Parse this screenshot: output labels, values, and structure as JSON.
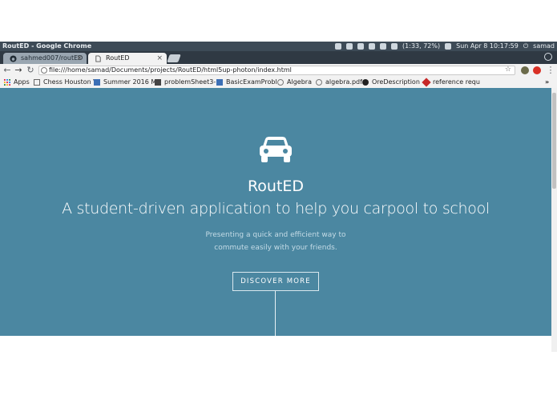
{
  "window": {
    "title": "RoutED - Google Chrome"
  },
  "system_tray": {
    "battery": "(1:33, 72%)",
    "datetime": "Sun Apr  8 10:17:59",
    "user": "samad"
  },
  "tabs": [
    {
      "label": "sahmed007/routED",
      "icon": "github-icon",
      "active": false
    },
    {
      "label": "RoutED",
      "icon": "page-icon",
      "active": true
    }
  ],
  "toolbar": {
    "url": "file:///home/samad/Documents/projects/RoutED/html5up-photon/index.html"
  },
  "bookmarks": [
    {
      "label": "Apps",
      "icon": "apps-grid-icon"
    },
    {
      "label": "Chess Houston \\",
      "icon": "page-icon"
    },
    {
      "label": "Summer 2016 M",
      "icon": "doc-icon"
    },
    {
      "label": "problemSheet3-",
      "icon": "doc-icon"
    },
    {
      "label": "BasicExamProbl",
      "icon": "doc-icon"
    },
    {
      "label": "Algebra",
      "icon": "file-icon"
    },
    {
      "label": "algebra.pdf",
      "icon": "file-icon"
    },
    {
      "label": "OreDescription",
      "icon": "doc-icon"
    },
    {
      "label": "reference requ",
      "icon": "stack-icon"
    }
  ],
  "hero": {
    "title": "RoutED",
    "subtitle": "A student-driven application to help you carpool to school",
    "desc_line1": "Presenting a quick and efficient way to",
    "desc_line2": "commute easily with your friends.",
    "button_label": "DISCOVER MORE",
    "background_color": "#4b87a1",
    "icon": "car-icon"
  }
}
